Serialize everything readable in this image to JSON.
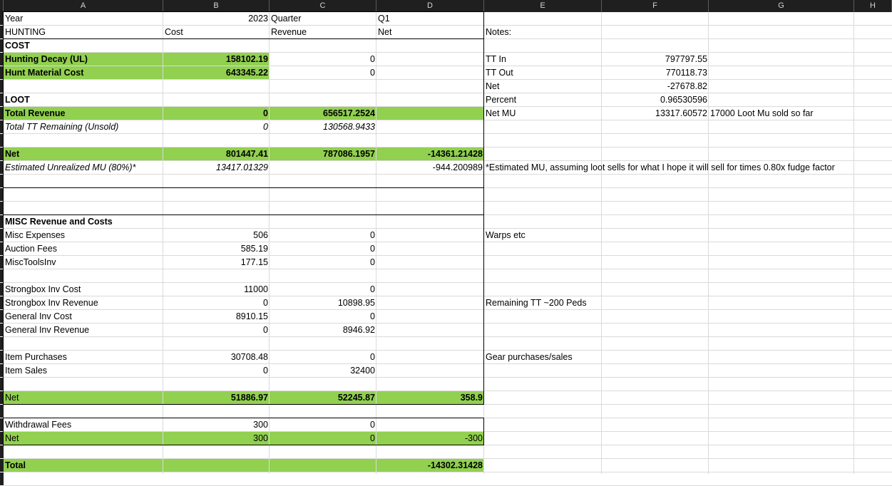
{
  "columns": [
    "A",
    "B",
    "C",
    "D",
    "E",
    "F",
    "G",
    "H"
  ],
  "colors": {
    "green_fill": "#92d050",
    "header_bg": "#1f1f1f",
    "gridline": "#dadada"
  },
  "cells": [
    {
      "r": 1,
      "c": "A",
      "v": "Year",
      "cls": ""
    },
    {
      "r": 1,
      "c": "B",
      "v": "2023",
      "cls": "r"
    },
    {
      "r": 1,
      "c": "C",
      "v": "Quarter",
      "cls": ""
    },
    {
      "r": 1,
      "c": "D",
      "v": "Q1",
      "cls": ""
    },
    {
      "r": 2,
      "c": "A",
      "v": "HUNTING",
      "cls": ""
    },
    {
      "r": 2,
      "c": "B",
      "v": "Cost",
      "cls": ""
    },
    {
      "r": 2,
      "c": "C",
      "v": "Revenue",
      "cls": ""
    },
    {
      "r": 2,
      "c": "D",
      "v": "Net",
      "cls": ""
    },
    {
      "r": 2,
      "c": "E",
      "v": "Notes:",
      "cls": ""
    },
    {
      "r": 3,
      "c": "A",
      "v": "COST",
      "cls": "b"
    },
    {
      "r": 4,
      "c": "A",
      "v": "Hunting Decay (UL)",
      "cls": "b"
    },
    {
      "r": 4,
      "c": "B",
      "v": "158102.19",
      "cls": "r b"
    },
    {
      "r": 4,
      "c": "C",
      "v": "0",
      "cls": "r"
    },
    {
      "r": 4,
      "c": "E",
      "v": "TT In",
      "cls": ""
    },
    {
      "r": 4,
      "c": "F",
      "v": "797797.55",
      "cls": "r"
    },
    {
      "r": 5,
      "c": "A",
      "v": "Hunt Material Cost",
      "cls": "b"
    },
    {
      "r": 5,
      "c": "B",
      "v": "643345.22",
      "cls": "r b"
    },
    {
      "r": 5,
      "c": "C",
      "v": "0",
      "cls": "r"
    },
    {
      "r": 5,
      "c": "E",
      "v": "TT Out",
      "cls": ""
    },
    {
      "r": 5,
      "c": "F",
      "v": "770118.73",
      "cls": "r"
    },
    {
      "r": 6,
      "c": "E",
      "v": "Net",
      "cls": ""
    },
    {
      "r": 6,
      "c": "F",
      "v": "-27678.82",
      "cls": "r"
    },
    {
      "r": 7,
      "c": "A",
      "v": "LOOT",
      "cls": "b"
    },
    {
      "r": 7,
      "c": "E",
      "v": "Percent",
      "cls": ""
    },
    {
      "r": 7,
      "c": "F",
      "v": "0.96530596",
      "cls": "r"
    },
    {
      "r": 8,
      "c": "A",
      "v": "Total Revenue",
      "cls": "b"
    },
    {
      "r": 8,
      "c": "B",
      "v": "0",
      "cls": "r b"
    },
    {
      "r": 8,
      "c": "C",
      "v": "656517.2524",
      "cls": "r b"
    },
    {
      "r": 8,
      "c": "E",
      "v": "Net MU",
      "cls": ""
    },
    {
      "r": 8,
      "c": "F",
      "v": "13317.60572",
      "cls": "r"
    },
    {
      "r": 8,
      "c": "G",
      "v": "17000 Loot Mu sold so far",
      "cls": ""
    },
    {
      "r": 9,
      "c": "A",
      "v": "Total TT Remaining (Unsold)",
      "cls": "i"
    },
    {
      "r": 9,
      "c": "B",
      "v": "0",
      "cls": "r i"
    },
    {
      "r": 9,
      "c": "C",
      "v": "130568.9433",
      "cls": "r i"
    },
    {
      "r": 11,
      "c": "A",
      "v": "Net",
      "cls": "b"
    },
    {
      "r": 11,
      "c": "B",
      "v": "801447.41",
      "cls": "r b"
    },
    {
      "r": 11,
      "c": "C",
      "v": "787086.1957",
      "cls": "r b"
    },
    {
      "r": 11,
      "c": "D",
      "v": "-14361.21428",
      "cls": "r b"
    },
    {
      "r": 12,
      "c": "A",
      "v": "Estimated Unrealized MU (80%)*",
      "cls": "i"
    },
    {
      "r": 12,
      "c": "B",
      "v": "13417.01329",
      "cls": "r i"
    },
    {
      "r": 12,
      "c": "D",
      "v": "-944.200989",
      "cls": "r"
    },
    {
      "r": 12,
      "c": "E",
      "v": "*Estimated MU, assuming loot sells for what I hope it will sell for times 0.80x fudge factor",
      "cls": ""
    },
    {
      "r": 16,
      "c": "A",
      "v": "MISC Revenue and Costs",
      "cls": "b"
    },
    {
      "r": 17,
      "c": "A",
      "v": "Misc Expenses",
      "cls": ""
    },
    {
      "r": 17,
      "c": "B",
      "v": "506",
      "cls": "r"
    },
    {
      "r": 17,
      "c": "C",
      "v": "0",
      "cls": "r"
    },
    {
      "r": 17,
      "c": "E",
      "v": "Warps etc",
      "cls": ""
    },
    {
      "r": 18,
      "c": "A",
      "v": "Auction Fees",
      "cls": ""
    },
    {
      "r": 18,
      "c": "B",
      "v": "585.19",
      "cls": "r"
    },
    {
      "r": 18,
      "c": "C",
      "v": "0",
      "cls": "r"
    },
    {
      "r": 19,
      "c": "A",
      "v": "MiscToolsInv",
      "cls": ""
    },
    {
      "r": 19,
      "c": "B",
      "v": "177.15",
      "cls": "r"
    },
    {
      "r": 19,
      "c": "C",
      "v": "0",
      "cls": "r"
    },
    {
      "r": 21,
      "c": "A",
      "v": "Strongbox Inv Cost",
      "cls": ""
    },
    {
      "r": 21,
      "c": "B",
      "v": "11000",
      "cls": "r"
    },
    {
      "r": 21,
      "c": "C",
      "v": "0",
      "cls": "r"
    },
    {
      "r": 22,
      "c": "A",
      "v": "Strongbox Inv Revenue",
      "cls": ""
    },
    {
      "r": 22,
      "c": "B",
      "v": "0",
      "cls": "r"
    },
    {
      "r": 22,
      "c": "C",
      "v": "10898.95",
      "cls": "r"
    },
    {
      "r": 22,
      "c": "E",
      "v": "Remaining TT ~200 Peds",
      "cls": ""
    },
    {
      "r": 23,
      "c": "A",
      "v": "General Inv Cost",
      "cls": ""
    },
    {
      "r": 23,
      "c": "B",
      "v": "8910.15",
      "cls": "r"
    },
    {
      "r": 23,
      "c": "C",
      "v": "0",
      "cls": "r"
    },
    {
      "r": 24,
      "c": "A",
      "v": "General Inv Revenue",
      "cls": ""
    },
    {
      "r": 24,
      "c": "B",
      "v": "0",
      "cls": "r"
    },
    {
      "r": 24,
      "c": "C",
      "v": "8946.92",
      "cls": "r"
    },
    {
      "r": 26,
      "c": "A",
      "v": "Item Purchases",
      "cls": ""
    },
    {
      "r": 26,
      "c": "B",
      "v": "30708.48",
      "cls": "r"
    },
    {
      "r": 26,
      "c": "C",
      "v": "0",
      "cls": "r"
    },
    {
      "r": 26,
      "c": "E",
      "v": "Gear purchases/sales",
      "cls": ""
    },
    {
      "r": 27,
      "c": "A",
      "v": "Item Sales",
      "cls": ""
    },
    {
      "r": 27,
      "c": "B",
      "v": "0",
      "cls": "r"
    },
    {
      "r": 27,
      "c": "C",
      "v": "32400",
      "cls": "r"
    },
    {
      "r": 29,
      "c": "A",
      "v": "Net",
      "cls": ""
    },
    {
      "r": 29,
      "c": "B",
      "v": "51886.97",
      "cls": "r b"
    },
    {
      "r": 29,
      "c": "C",
      "v": "52245.87",
      "cls": "r b"
    },
    {
      "r": 29,
      "c": "D",
      "v": "358.9",
      "cls": "r b"
    },
    {
      "r": 31,
      "c": "A",
      "v": "Withdrawal Fees",
      "cls": ""
    },
    {
      "r": 31,
      "c": "B",
      "v": "300",
      "cls": "r"
    },
    {
      "r": 31,
      "c": "C",
      "v": "0",
      "cls": "r"
    },
    {
      "r": 32,
      "c": "A",
      "v": "Net",
      "cls": ""
    },
    {
      "r": 32,
      "c": "B",
      "v": "300",
      "cls": "r"
    },
    {
      "r": 32,
      "c": "C",
      "v": "0",
      "cls": "r"
    },
    {
      "r": 32,
      "c": "D",
      "v": "-300",
      "cls": "r"
    },
    {
      "r": 34,
      "c": "A",
      "v": "Total",
      "cls": "b"
    },
    {
      "r": 34,
      "c": "D",
      "v": "-14302.31428",
      "cls": "r b"
    }
  ]
}
